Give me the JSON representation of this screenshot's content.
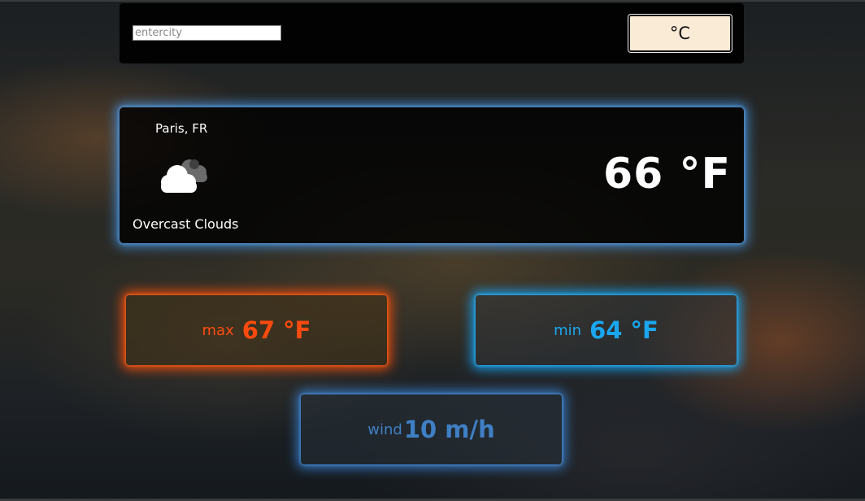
{
  "search": {
    "placeholder": "entercity",
    "value": ""
  },
  "unit_toggle": {
    "label": "°C"
  },
  "current": {
    "location": "Paris, FR",
    "icon": "overcast-clouds-icon",
    "description": "Overcast Clouds",
    "temperature": "66 °F"
  },
  "stats": {
    "max": {
      "label": "max",
      "value": "67 °F",
      "color": "#ff4b0f"
    },
    "min": {
      "label": "min",
      "value": "64 °F",
      "color": "#1aa7f0"
    },
    "wind": {
      "label": "wind",
      "value": "10 m/h",
      "color": "#3f7fc4"
    }
  }
}
